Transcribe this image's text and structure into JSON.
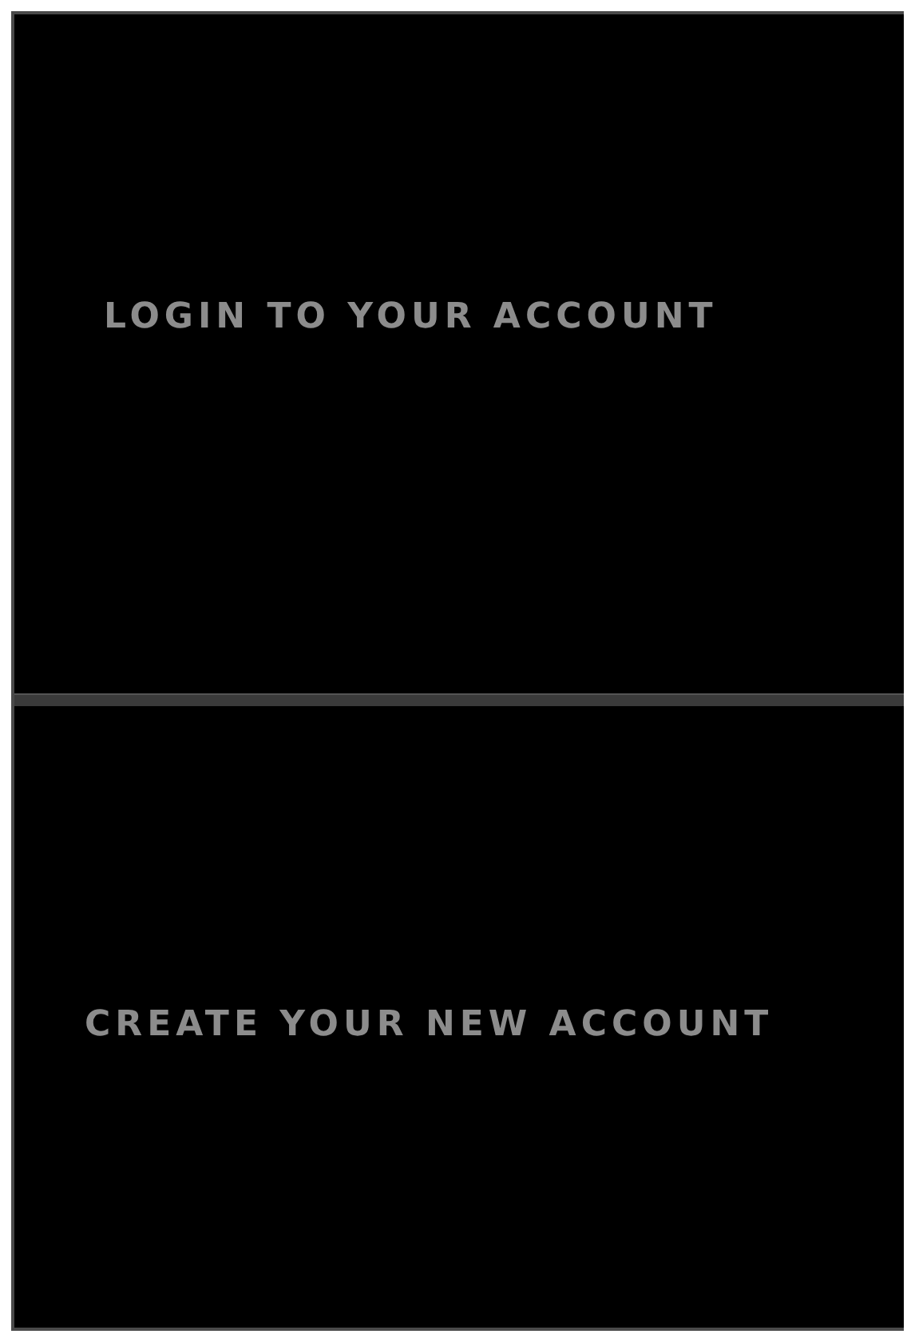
{
  "panels": [
    {
      "label": "LOGIN TO YOUR ACCOUNT"
    },
    {
      "label": "CREATE YOUR NEW ACCOUNT"
    }
  ]
}
